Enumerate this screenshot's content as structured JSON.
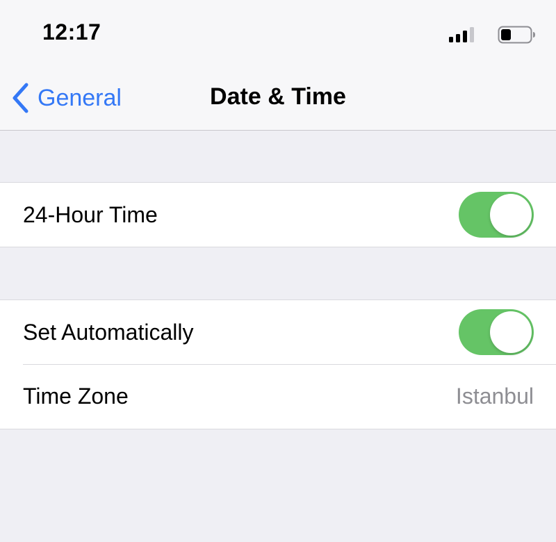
{
  "status_bar": {
    "time": "12:17",
    "icons": [
      "cellular-signal-icon",
      "battery-icon"
    ]
  },
  "nav": {
    "back_label": "General",
    "title": "Date & Time"
  },
  "settings": {
    "hour24": {
      "label": "24-Hour Time",
      "on": true
    },
    "set_automatically": {
      "label": "Set Automatically",
      "on": true
    },
    "time_zone": {
      "label": "Time Zone",
      "value": "Istanbul"
    }
  },
  "colors": {
    "accent": "#3478f6",
    "toggle_on": "#65c466",
    "background": "#efeff4",
    "secondary_text": "#8e8e93"
  }
}
